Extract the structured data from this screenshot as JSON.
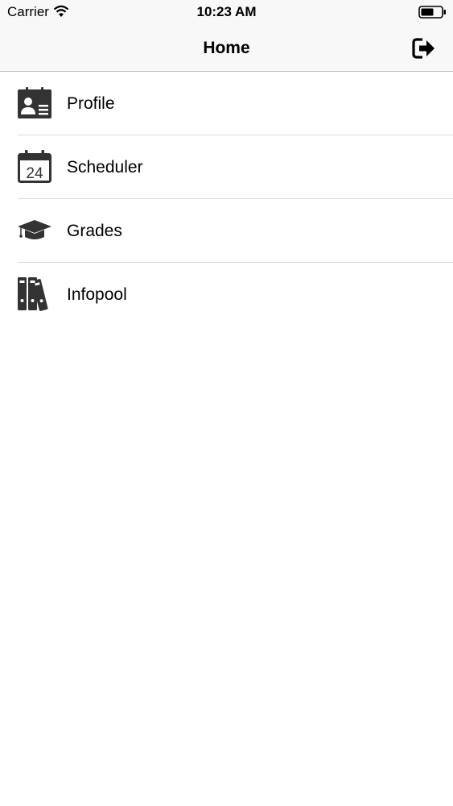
{
  "status_bar": {
    "carrier": "Carrier",
    "time": "10:23 AM"
  },
  "nav_bar": {
    "title": "Home",
    "logout_icon": "logout-icon"
  },
  "menu": [
    {
      "label": "Profile",
      "icon": "profile-card-icon"
    },
    {
      "label": "Scheduler",
      "icon": "calendar-icon"
    },
    {
      "label": "Grades",
      "icon": "graduation-cap-icon"
    },
    {
      "label": "Infopool",
      "icon": "binders-icon"
    }
  ],
  "colors": {
    "bar_background": "#f8f8f8",
    "icon": "#333333",
    "separator": "#d9d9d9"
  }
}
